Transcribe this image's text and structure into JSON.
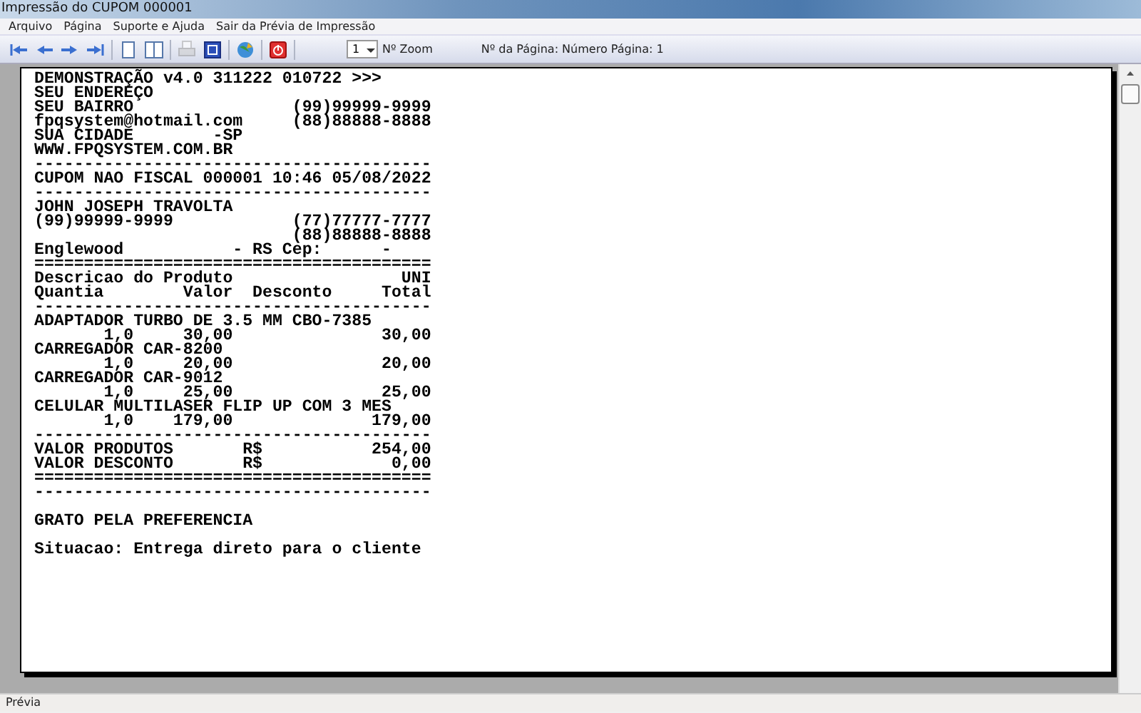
{
  "window": {
    "title": "Impressão do CUPOM 000001"
  },
  "menu": [
    {
      "label": "Arquivo"
    },
    {
      "label": "Página"
    },
    {
      "label": "Suporte e Ajuda"
    },
    {
      "label": "Sair da Prévia de Impressão"
    }
  ],
  "toolbar": {
    "groups": [
      [
        {
          "kind": "first",
          "disabled": false
        },
        {
          "kind": "prev",
          "disabled": false
        },
        {
          "kind": "next",
          "disabled": false
        },
        {
          "kind": "last",
          "disabled": false
        }
      ],
      [
        {
          "kind": "one-page",
          "disabled": false
        },
        {
          "kind": "two-pages",
          "disabled": false
        }
      ],
      [
        {
          "kind": "print",
          "disabled": true
        },
        {
          "kind": "export",
          "disabled": false
        }
      ],
      [
        {
          "kind": "globe",
          "disabled": false
        }
      ],
      [
        {
          "kind": "power",
          "disabled": false
        }
      ]
    ],
    "zoom_select": {
      "value": "1",
      "label": "Nº Zoom"
    },
    "page_label": "Nº da Página: Número Página: 1"
  },
  "receipt": {
    "blocks": [
      [
        "DEMONSTRAÇÃO v4.0 311222 010722 >>>",
        "SEU ENDEREÇO",
        "SEU BAIRRO                (99)99999-9999",
        "fpqsystem@hotmail.com     (88)88888-8888",
        "SUA CIDADE        -SP",
        "WWW.FPQSYSTEM.COM.BR",
        "----------------------------------------",
        "CUPOM NAO FISCAL 000001 10:46 05/08/2022",
        "----------------------------------------",
        "JOHN JOSEPH TRAVOLTA",
        "(99)99999-9999            (77)77777-7777",
        "                          (88)88888-8888",
        "Englewood           - RS Cep:      -",
        "========================================",
        "Descricao do Produto                 UNI",
        "Quantia        Valor  Desconto     Total",
        "----------------------------------------",
        "ADAPTADOR TURBO DE 3.5 MM CBO-7385",
        "       1,0     30,00               30,00",
        "CARREGADOR CAR-8200",
        "       1,0     20,00               20,00",
        "CARREGADOR CAR-9012",
        "       1,0     25,00               25,00",
        "CELULAR MULTILASER FLIP UP COM 3 MES",
        "       1,0    179,00              179,00",
        "----------------------------------------",
        "VALOR PRODUTOS       R$           254,00",
        "VALOR DESCONTO       R$             0,00",
        "========================================",
        "----------------------------------------"
      ],
      [
        "GRATO PELA PREFERENCIA"
      ],
      [
        "Situacao: Entrega direto para o cliente"
      ]
    ]
  },
  "status_bar": {
    "text": "Prévia"
  }
}
